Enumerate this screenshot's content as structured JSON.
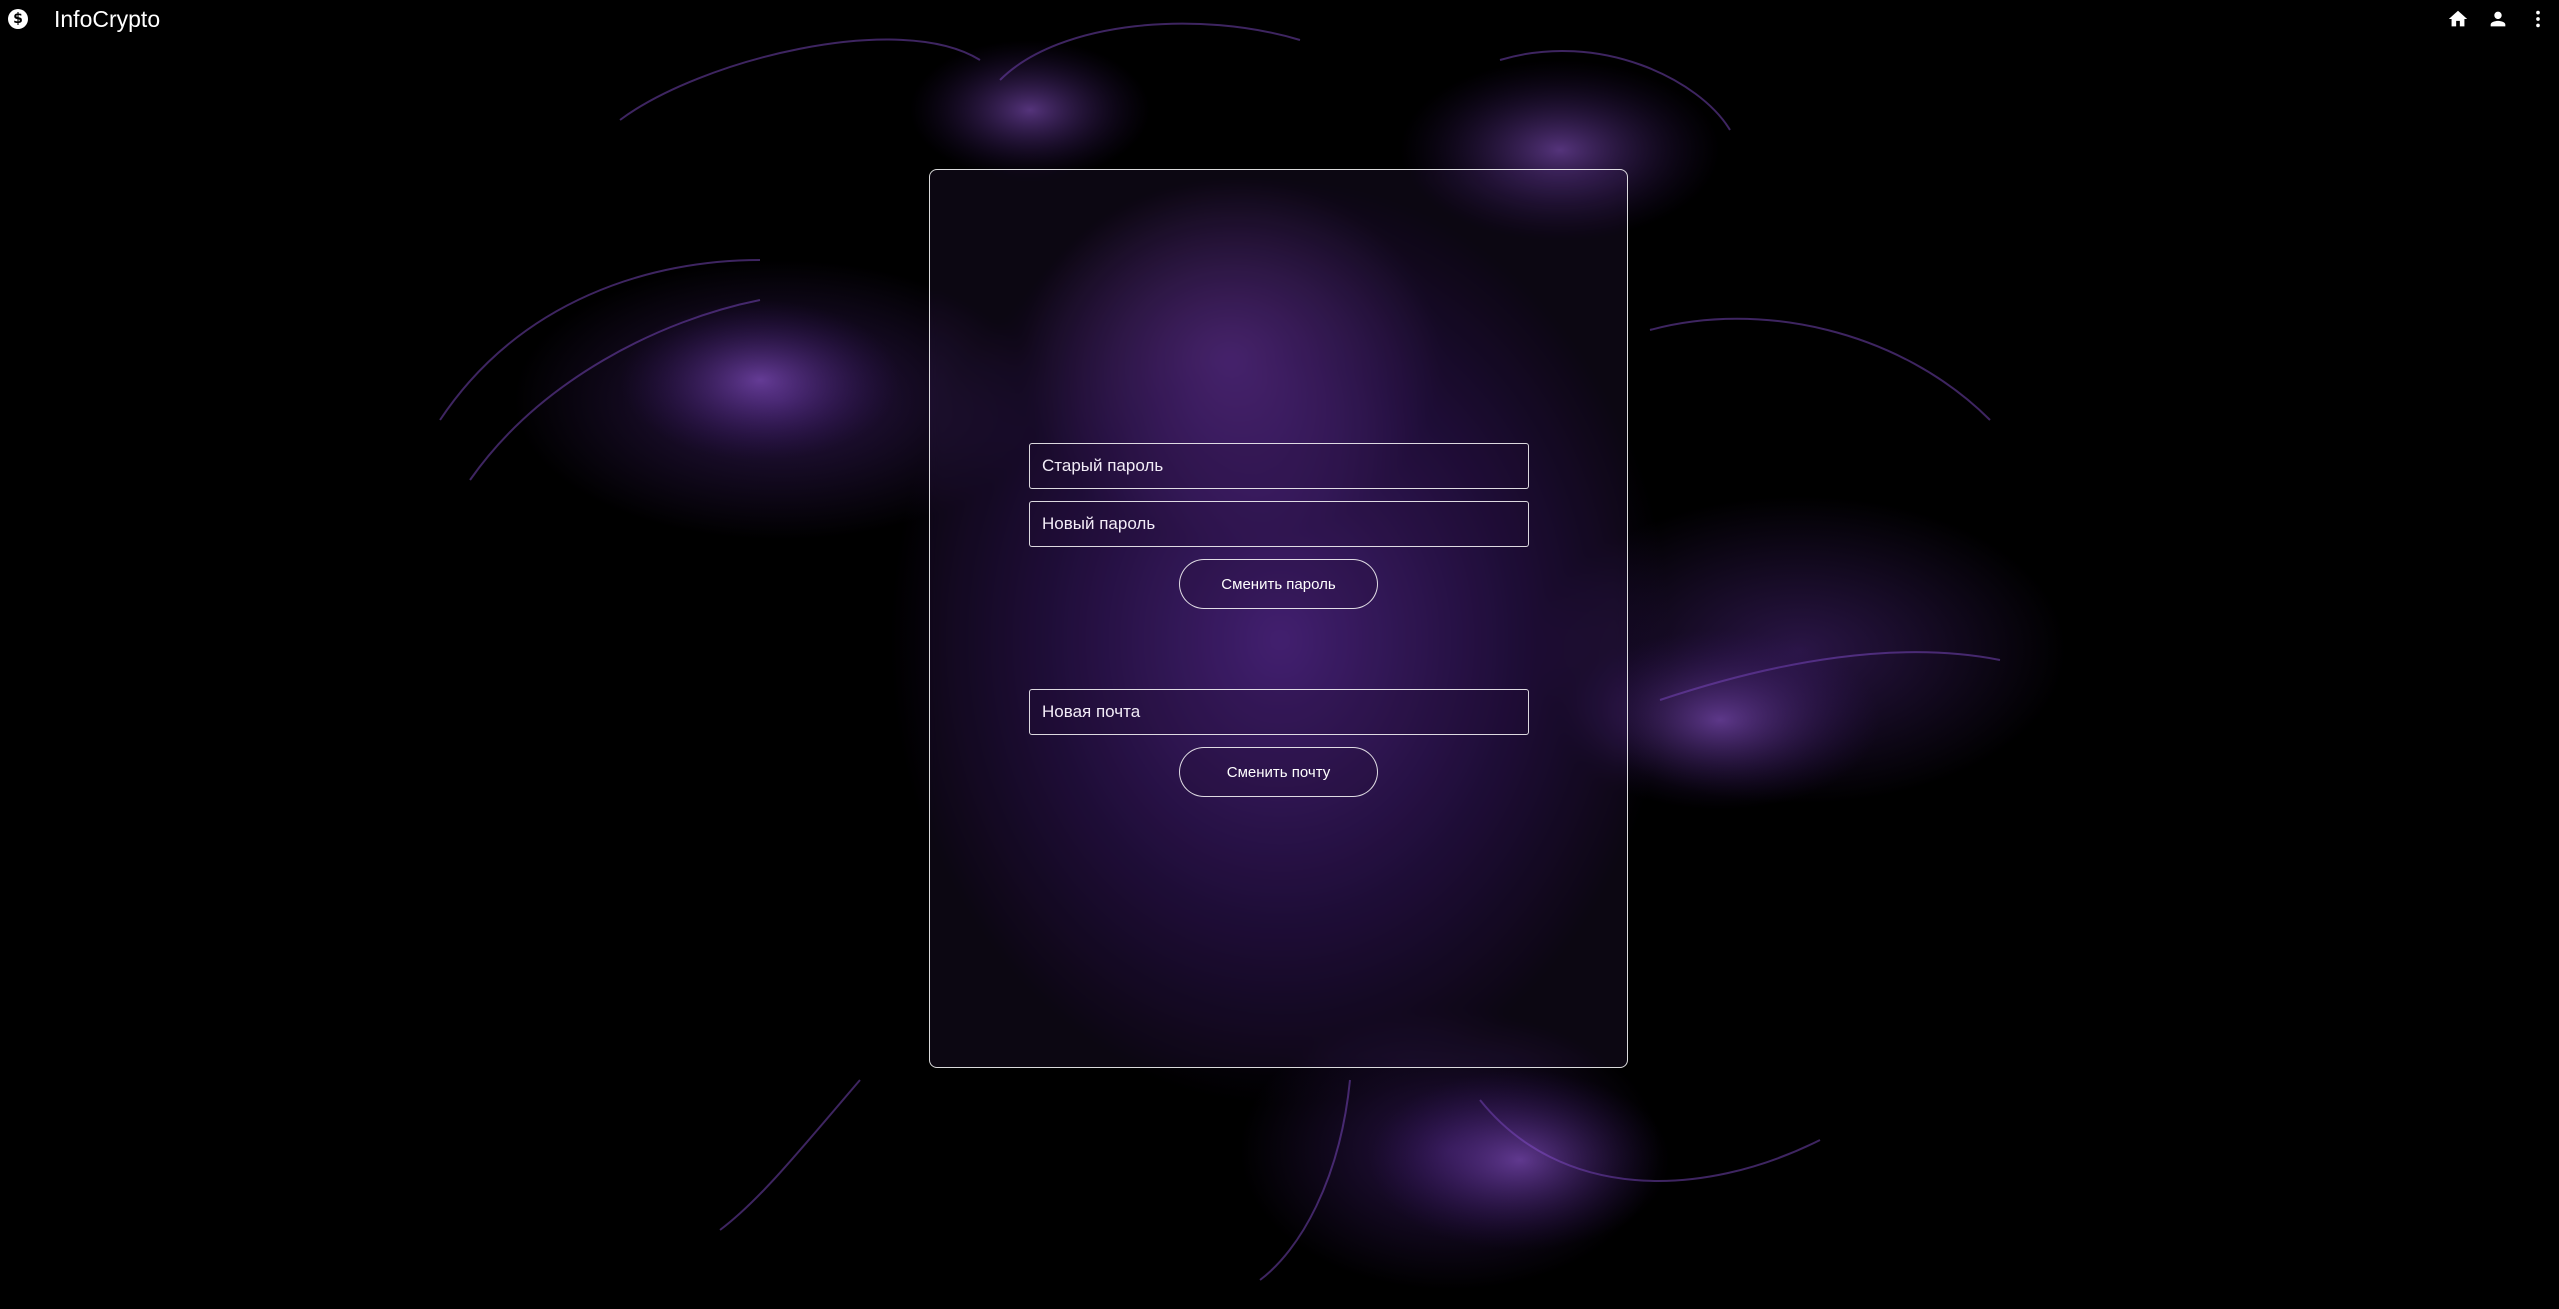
{
  "header": {
    "title": "InfoCrypto",
    "logo_glyph": "$",
    "actions": [
      "home-icon",
      "account-icon",
      "more-vert-icon"
    ]
  },
  "password_form": {
    "old_password_placeholder": "Старый пароль",
    "new_password_placeholder": "Новый пароль",
    "submit_label": "Сменить пароль"
  },
  "email_form": {
    "new_email_placeholder": "Новая почта",
    "submit_label": "Сменить почту"
  },
  "colors": {
    "background": "#000000",
    "accent": "#7a3fd0",
    "border": "#ffffff"
  }
}
